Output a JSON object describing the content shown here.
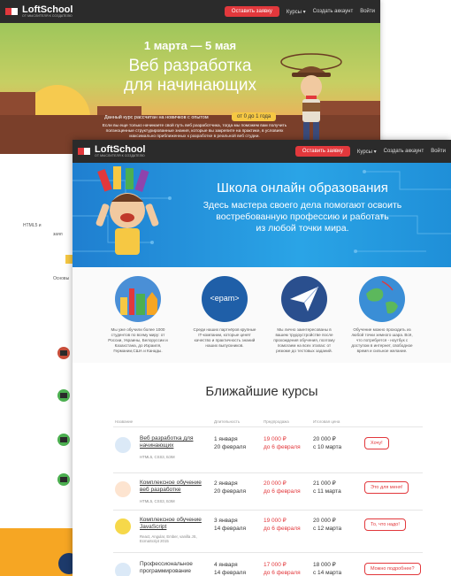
{
  "back_page": {
    "nav": {
      "logo_name": "LoftSchool",
      "logo_sub": "ОТ МЫСЛИТЕЛЯ К СОЗДАТЕЛЮ",
      "cta": "Оставить заявку",
      "courses": "Курсы ▾",
      "signup": "Создать аккаунт",
      "login": "Войти"
    },
    "hero": {
      "date": "1 марта — 5 мая",
      "title_line1": "Веб разработка",
      "title_line2": "для начинающих",
      "note": "Данный курс рассчитан на новичков с опытом",
      "badge": "от 0 до 1 года",
      "desc": "Если вы еще только начинаете свой путь веб разработчика, тогда мы поможем вам получить ползноценные структурированные знания, которые вы закрепите на практике, в условиях максимально приближенных к разработке в реальной веб студии."
    },
    "side": {
      "text1": "HTML5 и",
      "text2": "заял",
      "text3": "Основы"
    }
  },
  "front_page": {
    "nav": {
      "logo_name": "LoftSchool",
      "logo_sub": "ОТ МЫСЛИТЕЛЯ К СОЗДАТЕЛЮ",
      "cta": "Оставить заявку",
      "courses": "Курсы ▾",
      "signup": "Создать аккаунт",
      "login": "Войти"
    },
    "hero": {
      "title": "Школа онлайн образования",
      "desc_line1": "Здесь мастера своего дела помогают освоить",
      "desc_line2": "востребованную профессию и работать",
      "desc_line3": "из любой точки мира."
    },
    "features": [
      {
        "icon": "city-landmarks-icon",
        "text": "Мы уже обучили более 1000 студентов по всему миру: от России, Украины, Белоруссии и Казахстана, до Израиля, Германии,США и Канады."
      },
      {
        "icon": "epam-logo-icon",
        "text": "Среди наших партнёров крупные IT-компании, которые ценят качество и практичность знаний наших выпускников."
      },
      {
        "icon": "paper-plane-icon",
        "text": "Мы лично заинтересованы в вашем трудоустройстве после прохождения обучения, поэтому помогаем на всех этапах: от резюме до тестовых заданий."
      },
      {
        "icon": "globe-icon",
        "text": "Обучение можно проходить из любой точки земного шара. Всё, что потребуется - ноутбук с доступом в интернет, свободное время и сильное желание."
      }
    ],
    "epam_label": "<epam>",
    "courses_title": "Ближайшие курсы",
    "table_headers": {
      "name": "Название",
      "duration": "Длительность",
      "presale": "Предпродажа",
      "final": "Итоговая цена"
    },
    "courses": [
      {
        "name": "Веб разработка для начинающих",
        "tags": "HTML5, CSS3, БЭМ",
        "start": "1 января",
        "end": "20 февраля",
        "presale_price": "19 000 ₽",
        "presale_until": "до 6 февраля",
        "final_price": "20 000 ₽",
        "final_from": "с 10 марта",
        "button": "Хочу!",
        "icon": "course-beginner-icon"
      },
      {
        "name": "Комплексное обучение веб разработке",
        "tags": "HTML5, CSS3, БЭМ",
        "start": "2 января",
        "end": "20 февраля",
        "presale_price": "20 000 ₽",
        "presale_until": "до 6 февраля",
        "final_price": "21 000 ₽",
        "final_from": "с 11 марта",
        "button": "Это для меня!",
        "icon": "course-html5-icon"
      },
      {
        "name": "Комплексное обучение JavaScript",
        "tags": "React, Angular, Ember, vanilla JS, EcmaScript 2015",
        "start": "3 января",
        "end": "14 февраля",
        "presale_price": "19 000 ₽",
        "presale_until": "до 6 февраля",
        "final_price": "20 000 ₽",
        "final_from": "с 12 марта",
        "button": "То, что надо!",
        "icon": "course-js-icon"
      },
      {
        "name": "Профессиональное программирование",
        "tags": "",
        "start": "4 января",
        "end": "14 февраля",
        "presale_price": "17 000 ₽",
        "presale_until": "до 6 февраля",
        "final_price": "18 000 ₽",
        "final_from": "с 14 марта",
        "button": "Можно подробнее?",
        "icon": "course-pro-icon"
      }
    ]
  }
}
